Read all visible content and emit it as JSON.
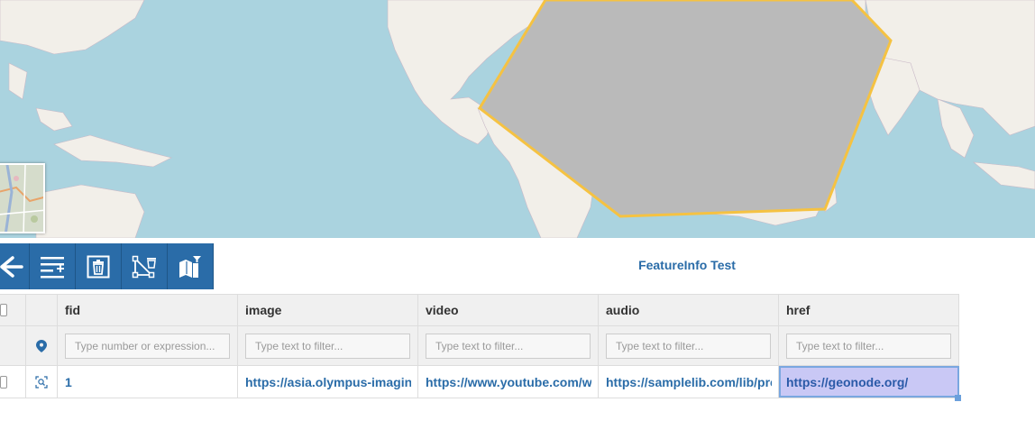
{
  "map": {
    "land_color": "#f2efe9",
    "water_color": "#aad3df",
    "feature_fill": "#bababa",
    "feature_stroke": "#f5c242"
  },
  "toolbar": {
    "color": "#2a6ca8",
    "buttons": [
      {
        "name": "back-icon"
      },
      {
        "name": "add-row-icon"
      },
      {
        "name": "delete-icon"
      },
      {
        "name": "delete-geometry-icon"
      },
      {
        "name": "sync-map-filter-icon"
      }
    ]
  },
  "grid": {
    "title": "FeatureInfo Test",
    "columns": [
      "fid",
      "image",
      "video",
      "audio",
      "href"
    ],
    "filters": [
      "Type number or expression...",
      "Type text to filter...",
      "Type text to filter...",
      "Type text to filter...",
      "Type text to filter..."
    ],
    "rows": [
      {
        "fid": "1",
        "image": "https://asia.olympus-imaging.",
        "video": "https://www.youtube.com/wa",
        "audio": "https://samplelib.com/lib/pre",
        "href": "https://geonode.org/"
      }
    ]
  }
}
